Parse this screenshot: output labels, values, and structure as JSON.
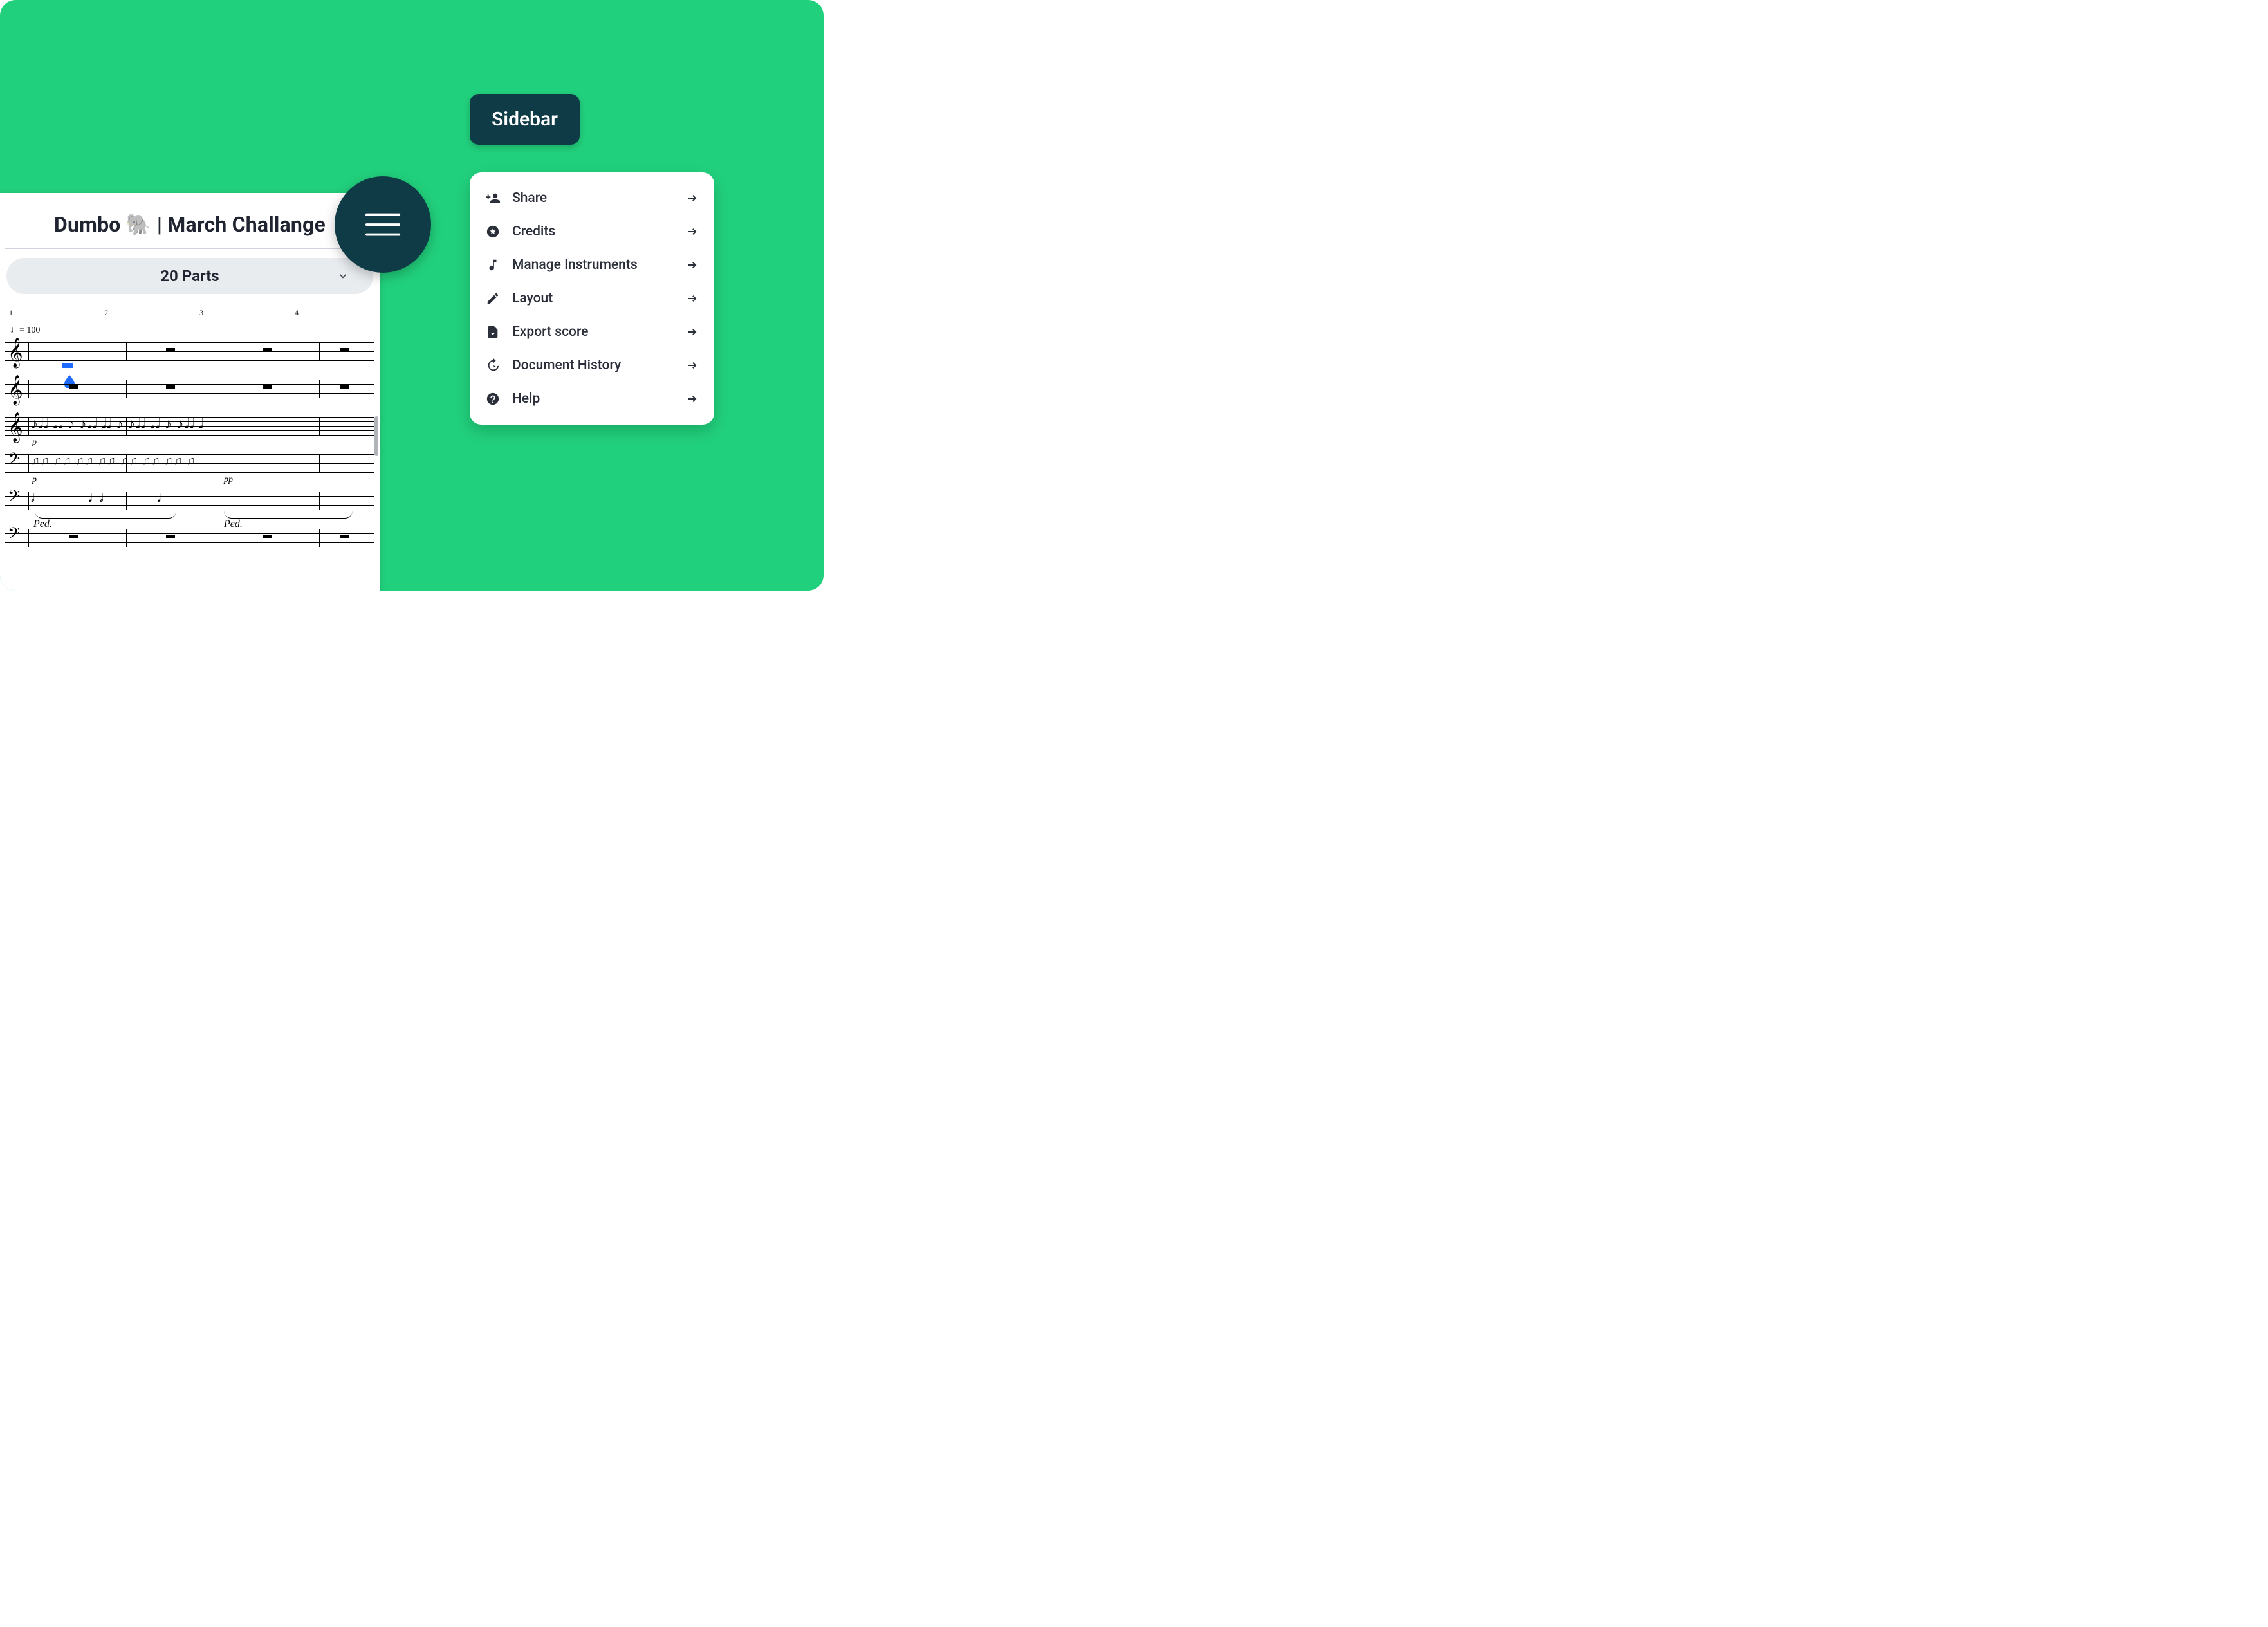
{
  "score": {
    "title": "Dumbo 🐘 | March Challange",
    "parts_button_label": "20 Parts",
    "bar_numbers": [
      "1",
      "2",
      "3",
      "4"
    ],
    "tempo": "♩= 100",
    "dynamics": {
      "p": "p",
      "pp": "pp"
    },
    "pedal_mark": "Ped."
  },
  "hamburger": {
    "aria": "Open sidebar"
  },
  "sidebar": {
    "title": "Sidebar",
    "items": [
      {
        "key": "share",
        "label": "Share",
        "icon": "person-plus-icon"
      },
      {
        "key": "credits",
        "label": "Credits",
        "icon": "star-circle-icon"
      },
      {
        "key": "manage",
        "label": "Manage Instruments",
        "icon": "music-note-icon"
      },
      {
        "key": "layout",
        "label": "Layout",
        "icon": "pencil-icon"
      },
      {
        "key": "export",
        "label": "Export score",
        "icon": "file-download-icon"
      },
      {
        "key": "history",
        "label": "Document History",
        "icon": "history-icon"
      },
      {
        "key": "help",
        "label": "Help",
        "icon": "help-circle-icon"
      }
    ]
  }
}
